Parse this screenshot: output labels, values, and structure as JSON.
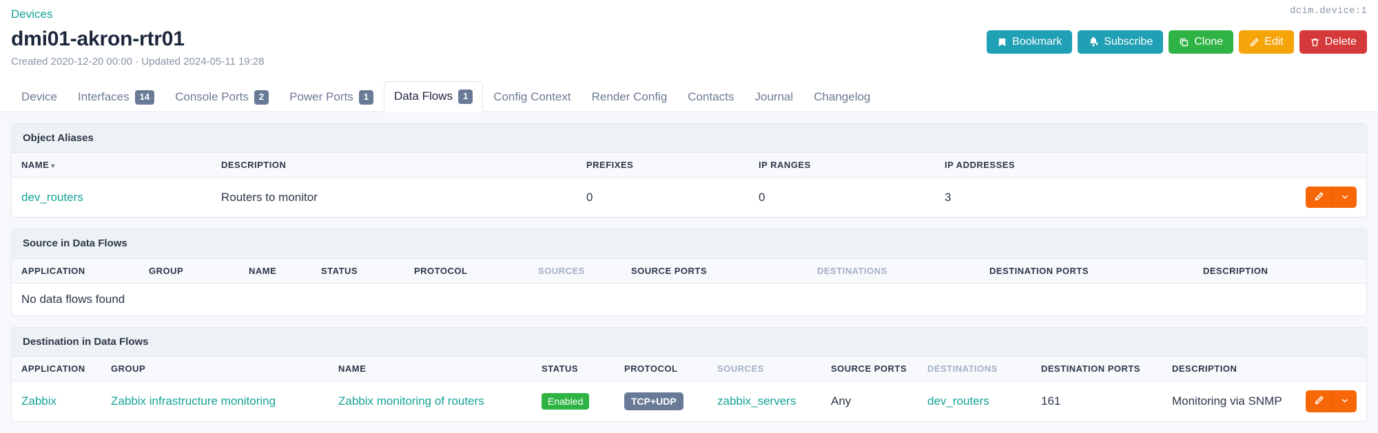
{
  "header": {
    "breadcrumb": "Devices",
    "title": "dmi01-akron-rtr01",
    "meta": "Created 2020-12-20 00:00 · Updated 2024-05-11 19:28",
    "object_type": "dcim.device:1",
    "actions": [
      {
        "label": "Bookmark",
        "icon": "bookmark-icon",
        "color": "#20a0b4"
      },
      {
        "label": "Subscribe",
        "icon": "bell-plus-icon",
        "color": "#20a0b4"
      },
      {
        "label": "Clone",
        "icon": "copy-icon",
        "color": "#2fb344"
      },
      {
        "label": "Edit",
        "icon": "pencil-icon",
        "color": "#f5a409"
      },
      {
        "label": "Delete",
        "icon": "trash-icon",
        "color": "#d63939"
      }
    ]
  },
  "tabs": [
    {
      "label": "Device",
      "badge": null,
      "active": false
    },
    {
      "label": "Interfaces",
      "badge": "14",
      "active": false
    },
    {
      "label": "Console Ports",
      "badge": "2",
      "active": false
    },
    {
      "label": "Power Ports",
      "badge": "1",
      "active": false
    },
    {
      "label": "Data Flows",
      "badge": "1",
      "active": true
    },
    {
      "label": "Config Context",
      "badge": null,
      "active": false
    },
    {
      "label": "Render Config",
      "badge": null,
      "active": false
    },
    {
      "label": "Contacts",
      "badge": null,
      "active": false
    },
    {
      "label": "Journal",
      "badge": null,
      "active": false
    },
    {
      "label": "Changelog",
      "badge": null,
      "active": false
    }
  ],
  "object_aliases": {
    "card_title": "Object Aliases",
    "columns": [
      {
        "label": "NAME",
        "sorted": true,
        "muted": false
      },
      {
        "label": "DESCRIPTION",
        "sorted": false,
        "muted": false
      },
      {
        "label": "PREFIXES",
        "sorted": false,
        "muted": false
      },
      {
        "label": "IP RANGES",
        "sorted": false,
        "muted": false
      },
      {
        "label": "IP ADDRESSES",
        "sorted": false,
        "muted": false
      }
    ],
    "rows": [
      {
        "name": "dev_routers",
        "description": "Routers to monitor",
        "prefixes": "0",
        "ip_ranges": "0",
        "ip_addresses": "3"
      }
    ]
  },
  "source_data_flows": {
    "card_title": "Source in Data Flows",
    "columns": [
      {
        "label": "APPLICATION",
        "muted": false
      },
      {
        "label": "GROUP",
        "muted": false
      },
      {
        "label": "NAME",
        "muted": false
      },
      {
        "label": "STATUS",
        "muted": false
      },
      {
        "label": "PROTOCOL",
        "muted": false
      },
      {
        "label": "SOURCES",
        "muted": true
      },
      {
        "label": "SOURCE PORTS",
        "muted": false
      },
      {
        "label": "DESTINATIONS",
        "muted": true
      },
      {
        "label": "DESTINATION PORTS",
        "muted": false
      },
      {
        "label": "DESCRIPTION",
        "muted": false
      }
    ],
    "empty_message": "No data flows found",
    "rows": []
  },
  "destination_data_flows": {
    "card_title": "Destination in Data Flows",
    "columns": [
      {
        "label": "APPLICATION",
        "muted": false
      },
      {
        "label": "GROUP",
        "muted": false
      },
      {
        "label": "NAME",
        "muted": false
      },
      {
        "label": "STATUS",
        "muted": false
      },
      {
        "label": "PROTOCOL",
        "muted": false
      },
      {
        "label": "SOURCES",
        "muted": true
      },
      {
        "label": "SOURCE PORTS",
        "muted": false
      },
      {
        "label": "DESTINATIONS",
        "muted": true
      },
      {
        "label": "DESTINATION PORTS",
        "muted": false
      },
      {
        "label": "DESCRIPTION",
        "muted": false
      }
    ],
    "rows": [
      {
        "application": "Zabbix",
        "group": "Zabbix infrastructure monitoring",
        "name": "Zabbix monitoring of routers",
        "status": "Enabled",
        "protocol": "TCP+UDP",
        "sources": "zabbix_servers",
        "source_ports": "Any",
        "destinations": "dev_routers",
        "destination_ports": "161",
        "description": "Monitoring via SNMP"
      }
    ]
  },
  "colors": {
    "link": "#13a394",
    "teal": "#20a0b4",
    "green": "#2fb344",
    "orange": "#f5a409",
    "red": "#d63939",
    "edit_orange": "#f76707",
    "badge_slate": "#697a96"
  },
  "row_action": {
    "edit_icon": "pencil-icon",
    "caret_icon": "chevron-down-icon"
  }
}
